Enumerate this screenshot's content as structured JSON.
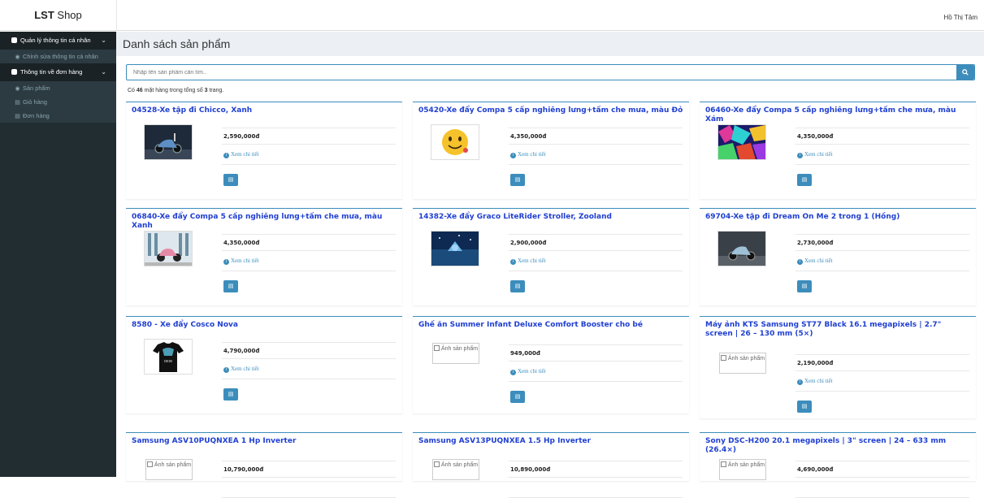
{
  "header": {
    "brand_bold": "LST",
    "brand_rest": " Shop",
    "user": "Hồ Thị Tâm"
  },
  "sidebar": {
    "groups": [
      {
        "label": "Quản lý thông tin cá nhân",
        "items": [
          "Chỉnh sửa thông tin cá nhân"
        ]
      },
      {
        "label": "Thông tin về đơn hàng",
        "items": [
          "Sản phẩm",
          "Giỏ hàng",
          "Đơn hàng"
        ]
      }
    ],
    "chevron": "⌄"
  },
  "main": {
    "title": "Danh sách sản phẩm",
    "search": {
      "placeholder": "Nhập tên sản phẩm cần tìm..",
      "button_icon": "search-icon"
    },
    "result_prefix": "Có ",
    "result_count": "46",
    "result_mid": " mặt hàng trong tổng số ",
    "result_pages": "3",
    "result_suffix": " trang."
  },
  "labels": {
    "detail": "Xem chi tiết",
    "broken_image_alt": "Ảnh sản phẩm"
  },
  "products": [
    {
      "title": "04528-Xe tập đi Chicco, Xanh",
      "price": "2,590,000đ",
      "image": "scooter-blue"
    },
    {
      "title": "05420-Xe đẩy Compa 5 cấp nghiêng lưng+tấm che mưa, màu Đỏ",
      "price": "4,350,000đ",
      "image": "emoji-smile"
    },
    {
      "title": "06460-Xe đẩy Compa 5 cấp nghiêng lưng+tấm che mưa, màu Xám",
      "price": "4,350,000đ",
      "image": "abstract-pattern"
    },
    {
      "title": "06840-Xe đẩy Compa 5 cấp nghiêng lưng+tấm che mưa, màu Xanh",
      "price": "4,350,000đ",
      "image": "scooter-pink"
    },
    {
      "title": "14382-Xe đẩy Graco LiteRider Stroller, Zooland",
      "price": "2,900,000đ",
      "image": "night-scene"
    },
    {
      "title": "69704-Xe tập đi Dream On Me 2 trong 1 (Hồng)",
      "price": "2,730,000đ",
      "image": "scooter-dark"
    },
    {
      "title": "8580 - Xe đẩy Cosco Nova",
      "price": "4,790,000đ",
      "image": "tshirt-dior",
      "shirt_text": "DIOR"
    },
    {
      "title": "Ghế ăn Summer Infant Deluxe Comfort Booster cho bé",
      "price": "949,000đ",
      "image": "broken"
    },
    {
      "title": "Máy ảnh KTS Samsung ST77 Black 16.1 megapixels | 2.7\" screen | 26 – 130 mm (5×)",
      "price": "2,190,000đ",
      "image": "broken"
    },
    {
      "title": "Samsung ASV10PUQNXEA 1 Hp Inverter",
      "price": "10,790,000đ",
      "image": "broken"
    },
    {
      "title": "Samsung ASV13PUQNXEA 1.5 Hp Inverter",
      "price": "10,890,000đ",
      "image": "broken"
    },
    {
      "title": "Sony DSC-H200 20.1 megapixels | 3\" screen | 24 – 633 mm (26.4×)",
      "price": "4,690,000đ",
      "image": "broken"
    }
  ],
  "colors": {
    "accent": "#3c8dbc",
    "title_link": "#1f3fd1",
    "sidebar_bg": "#222d32"
  }
}
